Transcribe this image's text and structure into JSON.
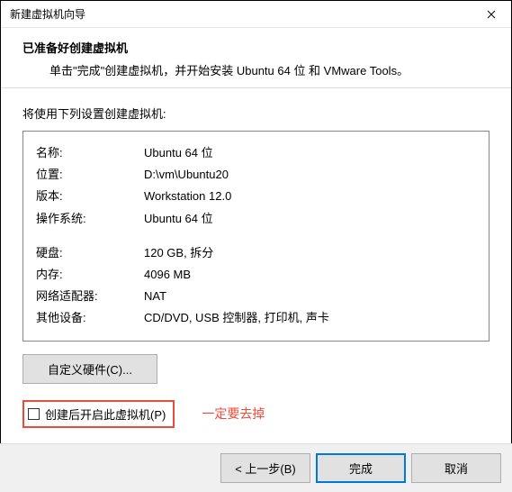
{
  "window": {
    "title": "新建虚拟机向导"
  },
  "header": {
    "title": "已准备好创建虚拟机",
    "subtitle": "单击\"完成\"创建虚拟机，并开始安装 Ubuntu 64 位 和 VMware Tools。"
  },
  "content": {
    "intro": "将使用下列设置创建虚拟机:"
  },
  "summary": {
    "rows": [
      {
        "label": "名称:",
        "value": "Ubuntu 64 位"
      },
      {
        "label": "位置:",
        "value": "D:\\vm\\Ubuntu20"
      },
      {
        "label": "版本:",
        "value": "Workstation 12.0"
      },
      {
        "label": "操作系统:",
        "value": "Ubuntu 64 位"
      }
    ],
    "rows2": [
      {
        "label": "硬盘:",
        "value": "120 GB, 拆分"
      },
      {
        "label": "内存:",
        "value": "4096 MB"
      },
      {
        "label": "网络适配器:",
        "value": "NAT"
      },
      {
        "label": "其他设备:",
        "value": "CD/DVD, USB 控制器, 打印机, 声卡"
      }
    ]
  },
  "buttons": {
    "customize": "自定义硬件(C)...",
    "checkbox_label": "创建后开启此虚拟机(P)",
    "annotation": "一定要去掉",
    "back": "< 上一步(B)",
    "finish": "完成",
    "cancel": "取消"
  }
}
